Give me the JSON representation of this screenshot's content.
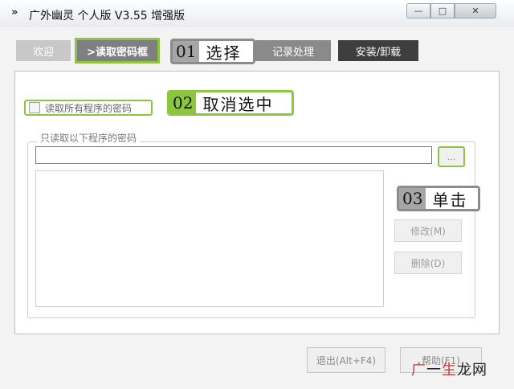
{
  "window": {
    "title": "广外幽灵 个人版 V3.55 增强版",
    "buttons": {
      "minimize": "—",
      "maximize": "□",
      "close": "✕"
    }
  },
  "tabs": [
    {
      "label": "欢迎"
    },
    {
      "label": ">读取密码框"
    },
    {
      "label": "记录处理"
    },
    {
      "label": "安装/卸载"
    }
  ],
  "callouts": [
    {
      "num": "01",
      "label": "选择"
    },
    {
      "num": "02",
      "label": "取消选中"
    },
    {
      "num": "03",
      "label": "单击"
    }
  ],
  "checkbox": {
    "label": "读取所有程序的密码",
    "checked": false
  },
  "group": {
    "legend": "只读取以下程序的密码",
    "path_value": "",
    "browse_label": "...",
    "modify_label": "修改(M)",
    "delete_label": "删除(D)"
  },
  "footer": {
    "exit_label": "退出(Alt+F4)",
    "help_label": "帮助(F1)"
  },
  "watermark": {
    "part1": "广",
    "part2": "一",
    "part3": "生",
    "part4": "龙网"
  },
  "colors": {
    "accent": "#8cc63f",
    "callout_gray": "#8c8c8c"
  }
}
